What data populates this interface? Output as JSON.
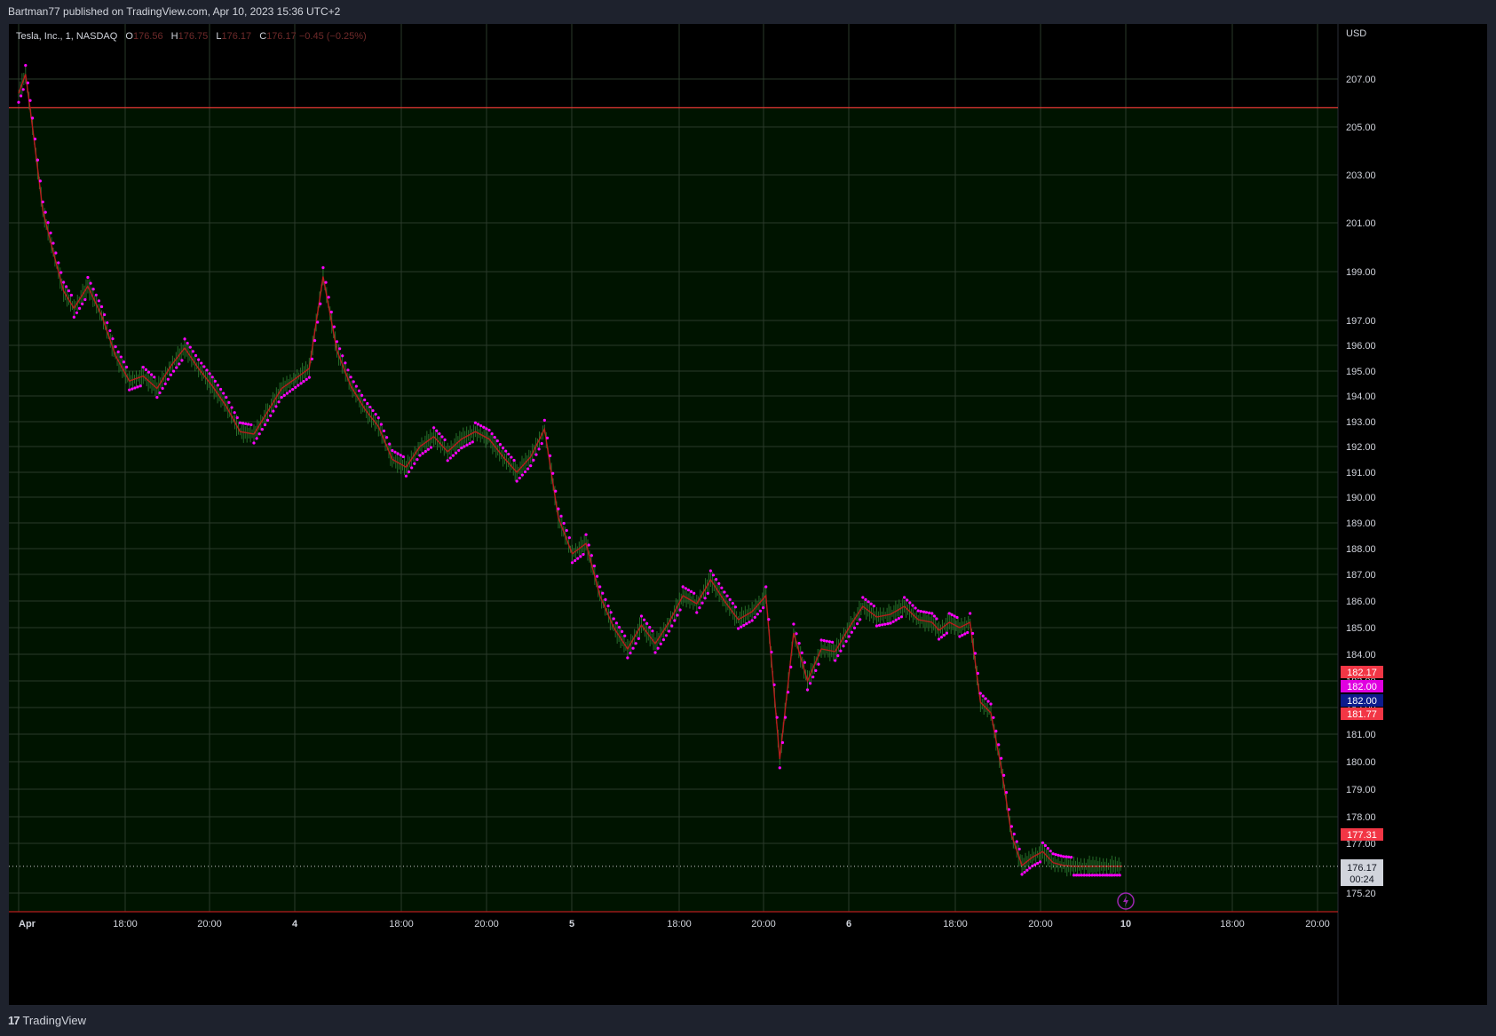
{
  "header": {
    "publisher_text": "Bartman77 published on TradingView.com, Apr 10, 2023 15:36 UTC+2"
  },
  "legend": {
    "symbol": "Tesla, Inc., 1, NASDAQ",
    "o_label": "O",
    "o_value": "176.56",
    "h_label": "H",
    "h_value": "176.75",
    "l_label": "L",
    "l_value": "176.17",
    "c_label": "C",
    "c_value": "176.17",
    "change": "−0.45 (−0.25%)"
  },
  "footer": {
    "brand": "TradingView",
    "brand_mark": "17"
  },
  "colors": {
    "background_top": "#000000",
    "background_chart": "#001400",
    "grid": "#2a3a2a",
    "price_line": "#b71c1c",
    "sar_dots": "#ff00ff",
    "candles": "#2e7d32",
    "hline": "#e53935",
    "current_price_line": "#cfcfcf"
  },
  "chart_data": {
    "type": "line",
    "title": "Tesla, Inc., 1, NASDAQ",
    "currency": "USD",
    "y_ticks": [
      "207.00",
      "205.00",
      "203.00",
      "201.00",
      "199.00",
      "197.00",
      "196.00",
      "195.00",
      "194.00",
      "193.00",
      "192.00",
      "191.00",
      "190.00",
      "189.00",
      "188.00",
      "187.00",
      "186.00",
      "185.00",
      "184.00",
      "183.00",
      "182.00",
      "181.00",
      "180.00",
      "179.00",
      "178.00",
      "177.00",
      "175.20"
    ],
    "x_ticks": [
      "Apr",
      "18:00",
      "20:00",
      "4",
      "18:00",
      "20:00",
      "5",
      "18:00",
      "20:00",
      "6",
      "18:00",
      "20:00",
      "10",
      "18:00",
      "20:00"
    ],
    "horizontal_line": 205.8,
    "price_labels": [
      {
        "text": "182.17",
        "value": 182.17,
        "color": "#f23645"
      },
      {
        "text": "182.00",
        "value": 182.0,
        "color": "#e000e0"
      },
      {
        "text": "182.00",
        "value": 182.0,
        "color": "#0d1b8c"
      },
      {
        "text": "181.77",
        "value": 181.77,
        "color": "#f23645"
      },
      {
        "text": "177.31",
        "value": 177.31,
        "color": "#f23645"
      }
    ],
    "current_price": {
      "price": "176.17",
      "countdown": "00:24",
      "value": 176.17
    },
    "series": [
      {
        "values_x": [
          0,
          0.2,
          0.4,
          0.7,
          1,
          1.3,
          1.6,
          2,
          2.4,
          2.8,
          3.2,
          3.6,
          4,
          4.4,
          4.8,
          5.2,
          5.6,
          6,
          6.4,
          6.8,
          7.2,
          7.6,
          8,
          8.4,
          8.8,
          9.2,
          9.6,
          10,
          10.4,
          10.8,
          11.2,
          11.6,
          12,
          12.4,
          12.8,
          13.2,
          13.6,
          14,
          14.4,
          14.8,
          15.2,
          15.6,
          16,
          16.4,
          16.8,
          17.2,
          17.6,
          18,
          18.4,
          18.8,
          19.2,
          19.6,
          20,
          20.4,
          20.8,
          21.2,
          21.6,
          22,
          22.4,
          22.8,
          23.2,
          23.6,
          24,
          24.4,
          24.8,
          25.2,
          25.6,
          26,
          26.4,
          26.6,
          26.9,
          27.2,
          27.5,
          27.8,
          28.1,
          28.4,
          28.7,
          29,
          29.3,
          29.6,
          29.9,
          30.2,
          30.5,
          30.8,
          31.1,
          31.4,
          31.6,
          31.9
        ],
        "values_y": [
          206.4,
          207.2,
          205.0,
          201.5,
          199.8,
          198.2,
          197.5,
          198.4,
          197.2,
          195.6,
          194.6,
          194.8,
          194.3,
          195.2,
          195.9,
          195.1,
          194.4,
          193.6,
          192.6,
          192.5,
          193.4,
          194.3,
          194.7,
          195.1,
          198.8,
          195.8,
          194.4,
          193.5,
          192.8,
          191.5,
          191.2,
          192.0,
          192.4,
          191.8,
          192.3,
          192.6,
          192.3,
          191.6,
          191.0,
          191.6,
          192.7,
          189.2,
          187.8,
          188.2,
          186.2,
          185.0,
          184.2,
          185.1,
          184.4,
          185.2,
          186.2,
          185.9,
          186.8,
          186.0,
          185.3,
          185.6,
          186.2,
          180.1,
          184.8,
          183.0,
          184.2,
          184.1,
          185.0,
          185.8,
          185.4,
          185.5,
          185.8,
          185.3,
          185.2,
          184.9,
          185.2,
          185.0,
          185.2,
          182.2,
          181.8,
          179.8,
          177.3,
          176.2,
          176.5,
          176.7,
          176.3,
          176.2,
          176.17,
          176.17,
          176.17,
          176.17,
          176.17,
          176.17
        ],
        "name": ""
      }
    ]
  }
}
